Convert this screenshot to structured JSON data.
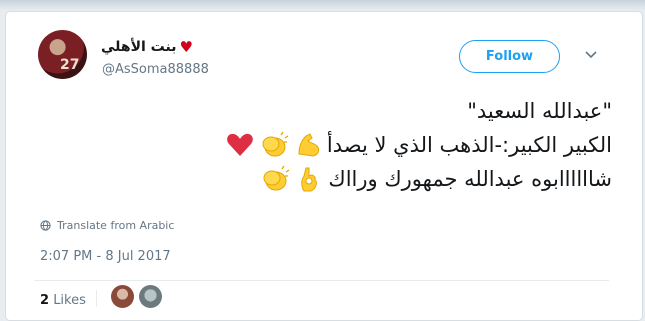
{
  "tweet": {
    "display_name": "بنت الأهلي",
    "handle": "@AsSoma88888",
    "follow_label": "Follow",
    "text_lines": [
      "\"عبدالله السعيد\"",
      "الكبير الكبير:-الذهب الذي لا يصدأ",
      "شاااااابوه عبدالله جمهورك ورااك"
    ],
    "translate_label": "Translate from Arabic",
    "timestamp": "2:07 PM - 8 Jul 2017",
    "likes_count": "2",
    "likes_label": "Likes"
  },
  "colors": {
    "accent": "#1da1f2",
    "heart": "#d0021b",
    "muted": "#657786"
  },
  "icons": {
    "display_name_icon": "red-heart-icon",
    "more_menu_icon": "chevron-down-icon",
    "translate_icon": "globe-icon",
    "line2_emojis": [
      "clapping-hands-icon",
      "flexed-biceps-icon",
      "red-heart-icon"
    ],
    "line3_emojis": [
      "clapping-hands-icon",
      "ok-hand-icon"
    ]
  }
}
